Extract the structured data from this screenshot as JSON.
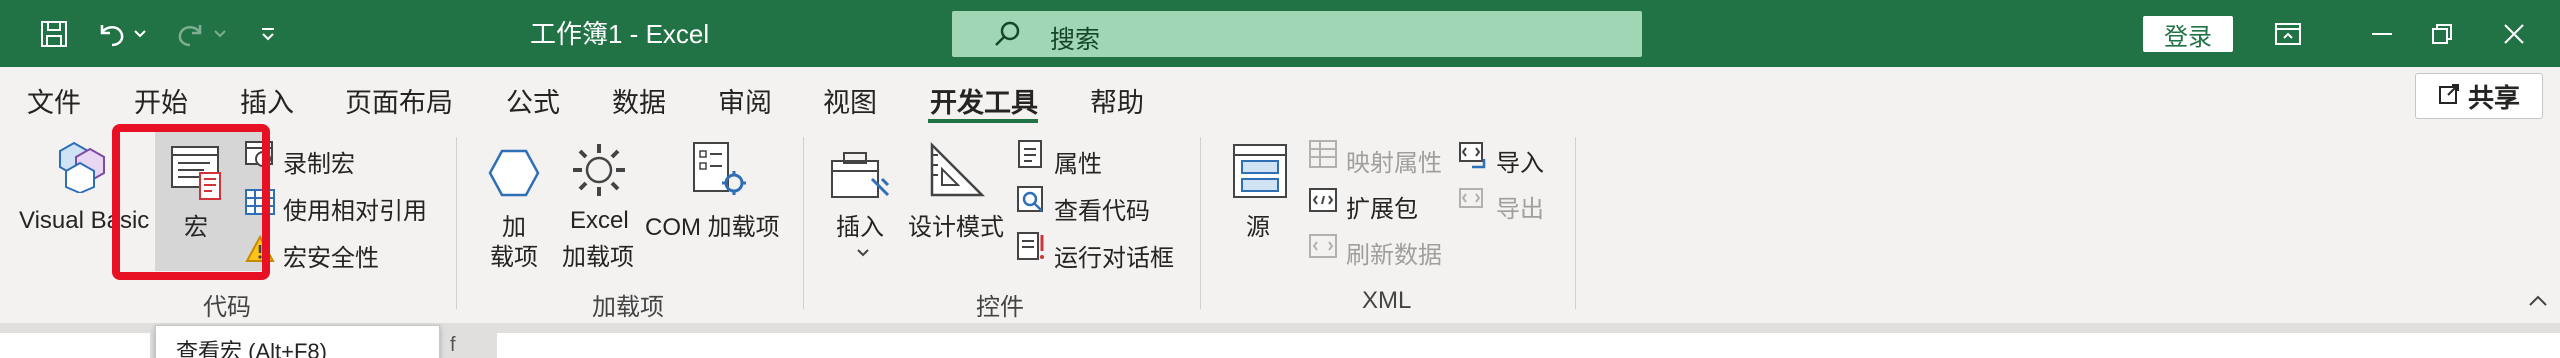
{
  "titlebar": {
    "title": "工作簿1  -  Excel",
    "search_placeholder": "搜索",
    "login_label": "登录",
    "bg": "#217346"
  },
  "tabs": [
    {
      "label": "文件"
    },
    {
      "label": "开始"
    },
    {
      "label": "插入"
    },
    {
      "label": "页面布局"
    },
    {
      "label": "公式"
    },
    {
      "label": "数据"
    },
    {
      "label": "审阅"
    },
    {
      "label": "视图"
    },
    {
      "label": "开发工具",
      "active": true
    },
    {
      "label": "帮助"
    }
  ],
  "share_label": "共享",
  "ribbon": {
    "code": {
      "label": "代码",
      "visual_basic": "Visual Basic",
      "macros": "宏",
      "record_macro": "录制宏",
      "relative_refs": "使用相对引用",
      "macro_security": "宏安全性"
    },
    "addins": {
      "label": "加载项",
      "addins_line1": "加",
      "addins_line2": "载项",
      "excel_addins_line1": "Excel",
      "excel_addins_line2": "加载项",
      "com_addins": "COM 加载项"
    },
    "controls": {
      "label": "控件",
      "insert": "插入",
      "design_mode": "设计模式",
      "properties": "属性",
      "view_code": "查看代码",
      "run_dialog": "运行对话框"
    },
    "xml": {
      "label": "XML",
      "source": "源",
      "map_properties": "映射属性",
      "expansion_packs": "扩展包",
      "refresh_data": "刷新数据",
      "import": "导入",
      "export": "导出"
    }
  },
  "tooltip": "查看宏 (Alt+F8)",
  "formula_fragment": "f",
  "colors": {
    "accent": "#217346",
    "highlight": "#e81123"
  }
}
